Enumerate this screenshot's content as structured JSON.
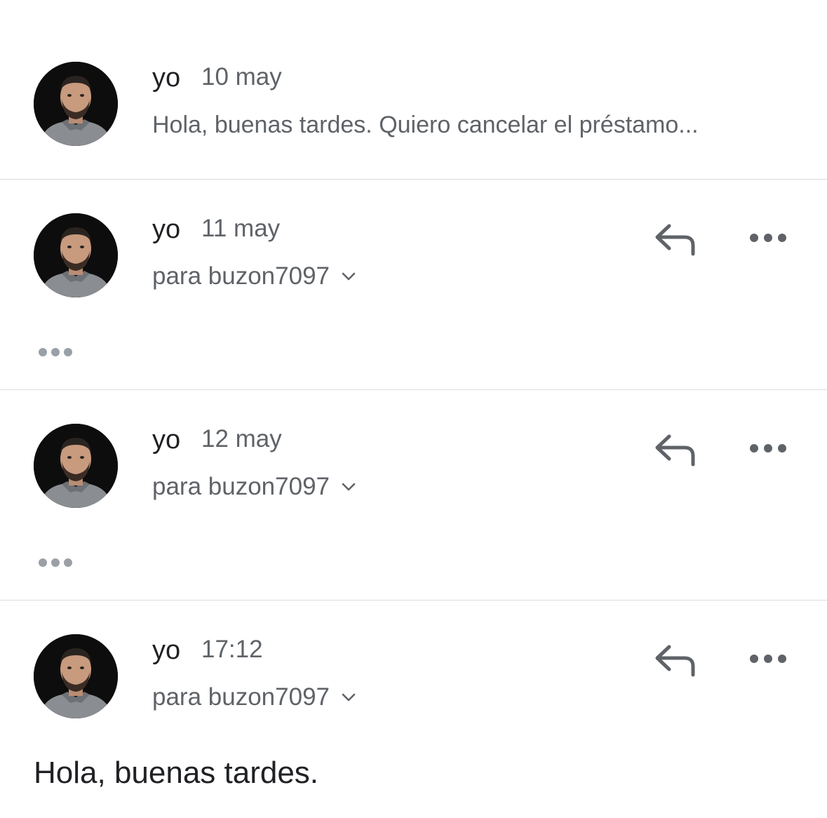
{
  "messages": [
    {
      "sender": "yo",
      "date": "10 may",
      "snippet": "Hola, buenas tardes. Quiero cancelar el préstamo..."
    },
    {
      "sender": "yo",
      "date": "11 may",
      "recipient": "para buzon7097"
    },
    {
      "sender": "yo",
      "date": "12 may",
      "recipient": "para buzon7097"
    },
    {
      "sender": "yo",
      "date": "17:12",
      "recipient": "para buzon7097",
      "body": "Hola, buenas tardes."
    }
  ],
  "icons": {
    "reply": "reply-icon",
    "more": "more-options-icon",
    "expand": "chevron-down-icon",
    "collapsed": "collapsed-content-icon"
  },
  "colors": {
    "primary_text": "#202124",
    "secondary_text": "#5f6368",
    "divider": "#dadce0",
    "icon": "#5f6368",
    "collapsed_dots": "#9aa0a6"
  }
}
